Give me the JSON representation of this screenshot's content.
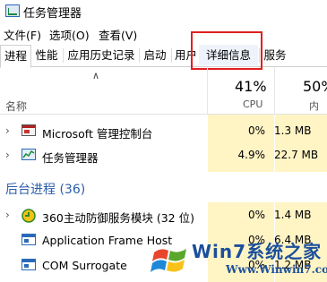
{
  "window": {
    "title": "任务管理器"
  },
  "menu": [
    "文件(F)",
    "选项(O)",
    "查看(V)"
  ],
  "tabs": [
    "进程",
    "性能",
    "应用历史记录",
    "启动",
    "用户",
    "详细信息",
    "服务"
  ],
  "active_tab": "进程",
  "highlighted_tab": "详细信息",
  "columns": {
    "name": "名称",
    "cpu": {
      "percent": "41%",
      "label": "CPU"
    },
    "mem": {
      "percent": "50%",
      "label": "内存"
    }
  },
  "apps": [
    {
      "name": "Microsoft 管理控制台",
      "cpu": "0%",
      "mem": "1.3 MB",
      "icon": "mmc-icon"
    },
    {
      "name": "任务管理器",
      "cpu": "4.9%",
      "mem": "22.7 MB",
      "icon": "task-manager-icon"
    }
  ],
  "background_group": {
    "label": "后台进程 (36)"
  },
  "background": [
    {
      "name": "360主动防御服务模块 (32 位)",
      "cpu": "0%",
      "mem": "1.4 MB",
      "icon": "360-shield-icon"
    },
    {
      "name": "Application Frame Host",
      "cpu": "0%",
      "mem": "6.4 MB",
      "icon": "window-icon"
    },
    {
      "name": "COM Surrogate",
      "cpu": "0%",
      "mem": "1.2 MB",
      "icon": "window-icon"
    }
  ],
  "watermark": {
    "main": "Win7系统之家",
    "url": "Www.Winwin7.com"
  },
  "colors": {
    "cpu_highlight": "#fff4c4",
    "group_blue": "#2a5da8",
    "callout_red": "#e0201f"
  }
}
